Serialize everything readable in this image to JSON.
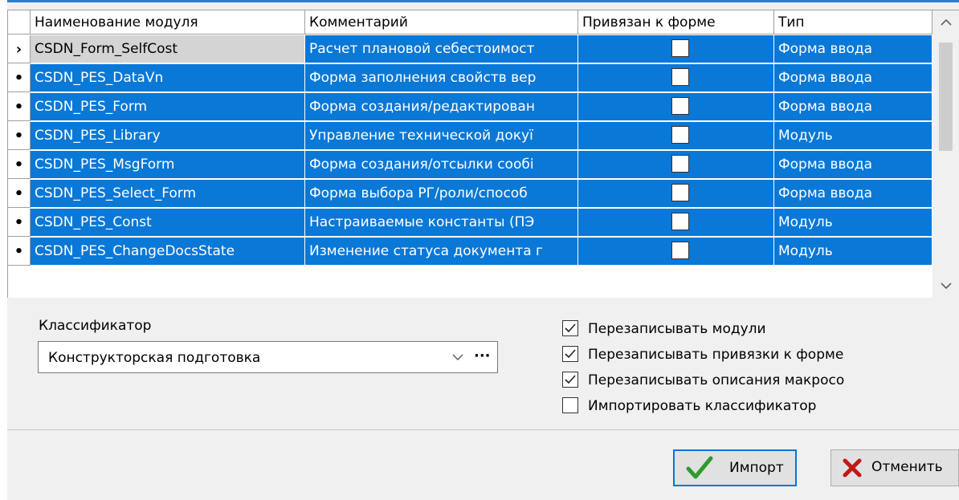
{
  "colors": {
    "selection": "#0a78d7",
    "accent": "#0078d7",
    "check_green": "#2e9b2e",
    "cancel_red": "#c01818"
  },
  "grid": {
    "headers": [
      "Наименование модуля",
      "Комментарий",
      "Привязан к форме",
      "Тип"
    ],
    "rows": [
      {
        "indicator": "›",
        "name": "CSDN_Form_SelfCost",
        "comment": "Расчет плановой себестоимост",
        "bound": false,
        "type": "Форма ввода"
      },
      {
        "indicator": "•",
        "name": "CSDN_PES_DataVn",
        "comment": "Форма заполнения свойств вер",
        "bound": false,
        "type": "Форма ввода"
      },
      {
        "indicator": "•",
        "name": "CSDN_PES_Form",
        "comment": "Форма создания/редактирован",
        "bound": false,
        "type": "Форма ввода"
      },
      {
        "indicator": "•",
        "name": "CSDN_PES_Library",
        "comment": "Управление технической докуї",
        "bound": false,
        "type": "Модуль"
      },
      {
        "indicator": "•",
        "name": "CSDN_PES_MsgForm",
        "comment": "Форма создания/отсылки сообі",
        "bound": false,
        "type": "Форма ввода"
      },
      {
        "indicator": "•",
        "name": "CSDN_PES_Select_Form",
        "comment": "Форма выбора РГ/роли/способ",
        "bound": false,
        "type": "Форма ввода"
      },
      {
        "indicator": "•",
        "name": "CSDN_PES_Const",
        "comment": "Настраиваемые константы (ПЭ",
        "bound": false,
        "type": "Модуль"
      },
      {
        "indicator": "•",
        "name": "CSDN_PES_ChangeDocsState",
        "comment": "Изменение статуса документа г",
        "bound": false,
        "type": "Модуль"
      }
    ],
    "scroll_up_icon": "chevron-up",
    "scroll_down_icon": "chevron-down"
  },
  "classifier": {
    "label": "Классификатор",
    "value": "Конструкторская подготовка",
    "chevron": "∨",
    "more": "···"
  },
  "options": [
    {
      "label": "Перезаписывать модули",
      "checked": true
    },
    {
      "label": "Перезаписывать привязки к форме",
      "checked": true
    },
    {
      "label": "Перезаписывать описания макросо",
      "checked": true
    },
    {
      "label": "Импортировать классификатор",
      "checked": false
    }
  ],
  "buttons": {
    "import_label": "Импорт",
    "cancel_label": "Отменить"
  }
}
